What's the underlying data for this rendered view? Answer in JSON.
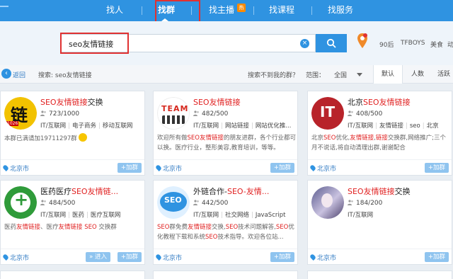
{
  "nav": {
    "items": [
      "找人",
      "找群",
      "找主播",
      "找课程",
      "找服务"
    ],
    "hot_badge": "热"
  },
  "search": {
    "value": "seo友情链接",
    "clear_icon": "clear-icon",
    "button_icon": "search-icon"
  },
  "hot_tags": [
    "90后",
    "TFBOYS",
    "美食",
    "动"
  ],
  "filter": {
    "back_label": "返回",
    "search_echo": "搜索: seo友情链接",
    "not_found": "搜索不到我的群？",
    "range_label": "范围：",
    "range_value": "全国",
    "sort_tabs": [
      "默认",
      "人数",
      "活跃"
    ]
  },
  "cards": [
    {
      "title_pre": "",
      "title_hl": "SEO友情链接",
      "title_post": "交换",
      "members": "723/1000",
      "tags": [
        "IT/互联网",
        "电子商务",
        "移动互联网"
      ],
      "desc_parts": [
        {
          "t": "本群已满请加19711297群",
          "h": false
        }
      ],
      "location": "北京市",
      "join_label": "+加群",
      "enter_label": "",
      "logo_text": "链",
      "logo_sub": "1026"
    },
    {
      "title_pre": "",
      "title_hl": "SEO友情链接",
      "title_post": "",
      "members": "482/500",
      "tags": [
        "IT/互联网",
        "网站链接",
        "网站优化推..."
      ],
      "desc_parts": [
        {
          "t": "欢迎所有做",
          "h": false
        },
        {
          "t": "SEO友情链接",
          "h": true
        },
        {
          "t": "的朋友进群，各个行业都可以换。医疗行业，整形美容,教育培训，等等。",
          "h": false
        }
      ],
      "location": "北京市",
      "join_label": "+加群",
      "enter_label": "",
      "logo_text": "TEAM"
    },
    {
      "title_pre": "北京",
      "title_hl": "SEO友情链接",
      "title_post": "",
      "members": "408/500",
      "tags": [
        "IT/互联网",
        "友情链接",
        "seo",
        "北京"
      ],
      "desc_parts": [
        {
          "t": "北京",
          "h": false
        },
        {
          "t": "SEO",
          "h": true
        },
        {
          "t": "优化,",
          "h": false
        },
        {
          "t": "友情链接",
          "h": true
        },
        {
          "t": ",",
          "h": false
        },
        {
          "t": "链接",
          "h": true
        },
        {
          "t": "交换群,网络推广;三个月不说话,将自动清理出群,谢谢配合",
          "h": false
        }
      ],
      "location": "北京市",
      "join_label": "+加群",
      "enter_label": "",
      "logo_text": "IT"
    },
    {
      "title_pre": "医药医疗",
      "title_hl": "SEO友情链...",
      "title_post": "",
      "members": "484/500",
      "tags": [
        "IT/互联网",
        "医药",
        "医疗互联网"
      ],
      "desc_parts": [
        {
          "t": "医药",
          "h": false
        },
        {
          "t": "友情链接",
          "h": true
        },
        {
          "t": "、医疗",
          "h": false
        },
        {
          "t": "友情链接",
          "h": true
        },
        {
          "t": " ",
          "h": false
        },
        {
          "t": "SEO",
          "h": true
        },
        {
          "t": " 交换群",
          "h": false
        }
      ],
      "location": "北京市",
      "join_label": "+加群",
      "enter_label": "» 进入",
      "logo_text": "+"
    },
    {
      "title_pre": "外链合作-",
      "title_hl": "SEO-友情...",
      "title_post": "",
      "members": "442/500",
      "tags": [
        "IT/互联网",
        "社交网络",
        "JavaScript"
      ],
      "desc_parts": [
        {
          "t": "SEO",
          "h": true
        },
        {
          "t": "群免费",
          "h": false
        },
        {
          "t": "友情链接",
          "h": true
        },
        {
          "t": "交换,",
          "h": false
        },
        {
          "t": "SEO",
          "h": true
        },
        {
          "t": "技术问题解答,",
          "h": false
        },
        {
          "t": "SEO",
          "h": true
        },
        {
          "t": "优化教程下载和系统",
          "h": false
        },
        {
          "t": "SEO",
          "h": true
        },
        {
          "t": "技术指导。欢迎各位站...",
          "h": false
        }
      ],
      "location": "北京市",
      "join_label": "+加群",
      "enter_label": "",
      "logo_text": "SEO"
    },
    {
      "title_pre": "",
      "title_hl": "SEO友情链接",
      "title_post": "交换",
      "members": "184/200",
      "tags": [
        "IT/互联网"
      ],
      "desc_parts": [],
      "location": "北京市",
      "join_label": "+加群",
      "enter_label": "",
      "logo_text": ""
    }
  ],
  "colors": {
    "primary": "#2f93e1",
    "highlight": "#e02020",
    "annotation": "#e03131"
  }
}
